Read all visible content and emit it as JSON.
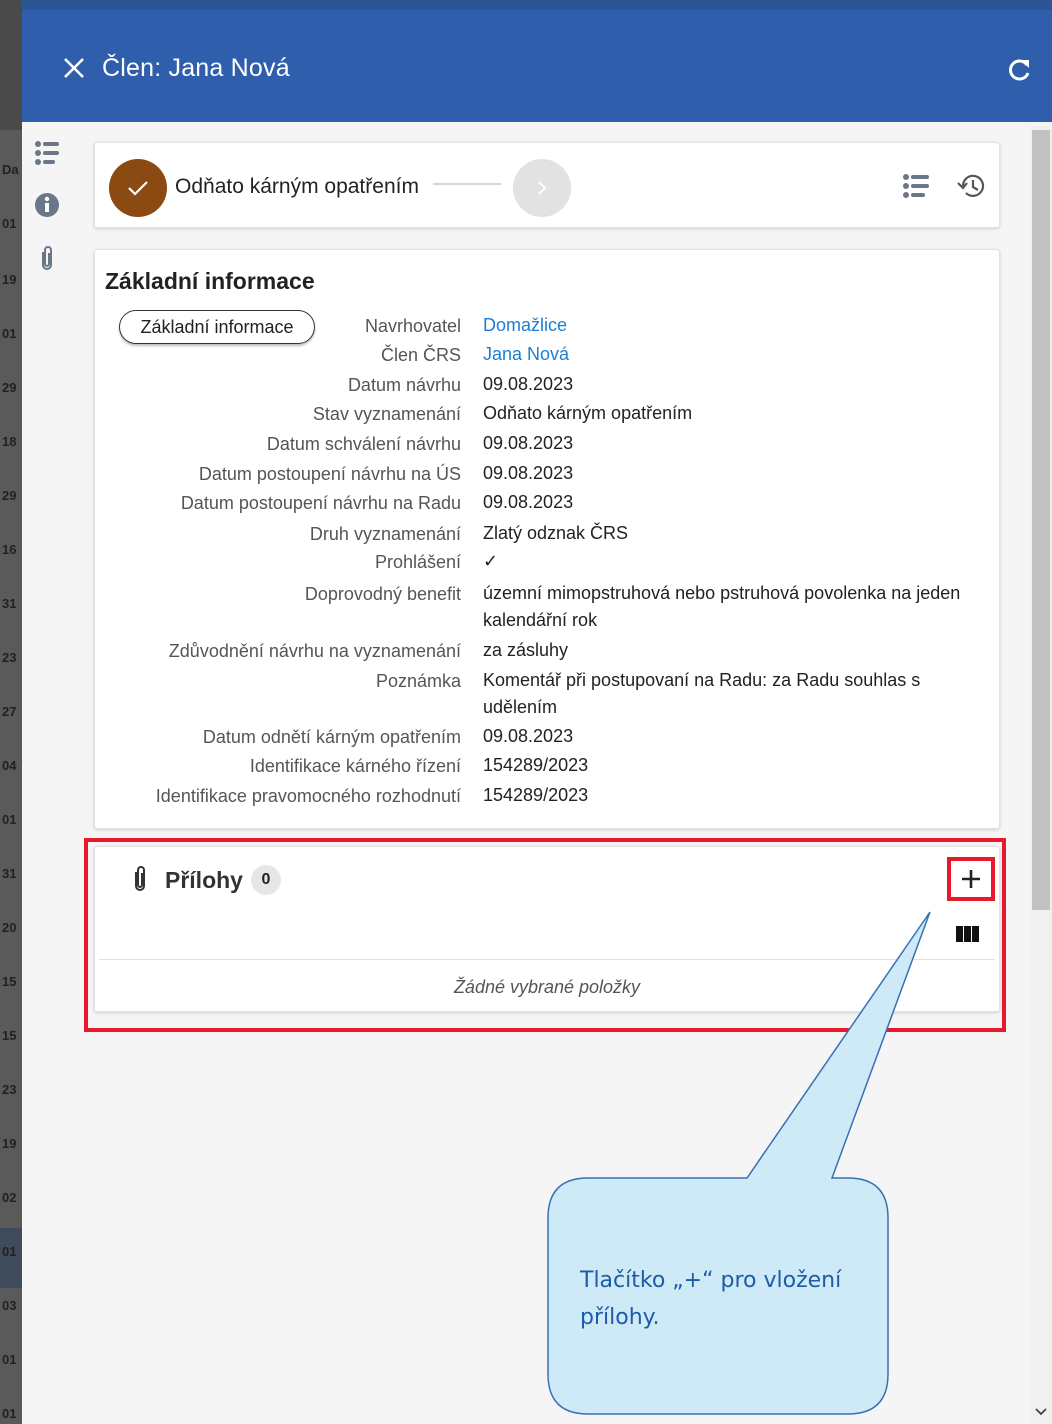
{
  "background_strip": [
    "Da",
    "01",
    "19",
    "01",
    "29",
    "18",
    "29",
    "16",
    "31",
    "23",
    "27",
    "04",
    "01",
    "31",
    "20",
    "15",
    "15",
    "23",
    "19",
    "02",
    "01",
    "03",
    "01",
    "01"
  ],
  "header": {
    "title": "Člen: Jana Nová",
    "close_icon": "close-icon",
    "refresh_icon": "refresh-icon",
    "color": "#2f5ead"
  },
  "rail": [
    "workflow-icon",
    "info-icon",
    "paperclip-icon"
  ],
  "status": {
    "label": "Odňato kárným opatřením",
    "done_color": "#8a4a12"
  },
  "info": {
    "title": "Základní informace",
    "tab": "Základní informace",
    "fields": [
      {
        "label": "Navrhovatel",
        "value": "Domažlice",
        "link": true
      },
      {
        "label": "Člen ČRS",
        "value": "Jana Nová",
        "link": true
      },
      {
        "label": "Datum návrhu",
        "value": "09.08.2023"
      },
      {
        "label": "Stav vyznamenání",
        "value": "Odňato kárným opatřením"
      },
      {
        "label": "Datum schválení návrhu",
        "value": "09.08.2023"
      },
      {
        "label": "Datum postoupení návrhu na ÚS",
        "value": "09.08.2023"
      },
      {
        "label": "Datum postoupení návrhu na Radu",
        "value": "09.08.2023"
      },
      {
        "label": "Druh vyznamenání",
        "value": "Zlatý odznak ČRS"
      },
      {
        "label": "Prohlášení",
        "value": "✓"
      },
      {
        "label": "Doprovodný benefit",
        "value": "územní mimopstruhová nebo pstruhová povolenka na jeden kalendářní rok"
      },
      {
        "label": "Zdůvodnění návrhu na vyznamenání",
        "value": "za zásluhy"
      },
      {
        "label": "Poznámka",
        "value": "Komentář při postupovaní na Radu: za Radu souhlas s udělením"
      },
      {
        "label": "Datum odnětí kárným opatřením",
        "value": "09.08.2023"
      },
      {
        "label": "Identifikace kárného řízení",
        "value": "154289/2023"
      },
      {
        "label": "Identifikace pravomocného rozhodnutí",
        "value": "154289/2023"
      }
    ]
  },
  "attachments": {
    "title": "Přílohy",
    "count": "0",
    "empty": "Žádné vybrané položky",
    "highlight_color": "#e8192c"
  },
  "callout": {
    "text": "Tlačítko „+“ pro vložení přílohy.",
    "fill": "#cdeaf6",
    "stroke": "#3a6fb5"
  }
}
